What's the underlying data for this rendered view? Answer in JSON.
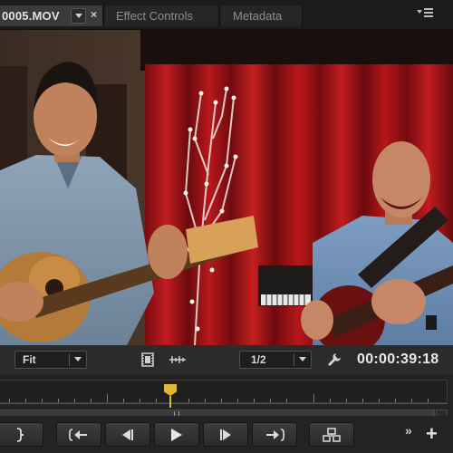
{
  "tabs": {
    "active_label": "0005.MOV",
    "close_symbol": "×",
    "effect_controls_label": "Effect Controls",
    "metadata_label": "Metadata"
  },
  "controls": {
    "zoom_value": "Fit",
    "resolution_value": "1/2",
    "timecode": "00:00:39:18"
  },
  "transport": {
    "mark_out_icon": "mark-out-brace-icon",
    "go_to_in_icon": "go-to-in-icon",
    "step_back_icon": "step-back-icon",
    "play_icon": "play-icon",
    "step_forward_icon": "step-forward-icon",
    "go_to_out_icon": "go-to-out-icon",
    "export_frame_icon": "export-frame-icon",
    "more_symbol": "»",
    "add_symbol": "+"
  },
  "playhead": {
    "color": "#e2b72f"
  },
  "colors": {
    "panel_bg": "#232323",
    "active_tab": "#3a3a3a",
    "curtain_red": "#b8181c"
  }
}
